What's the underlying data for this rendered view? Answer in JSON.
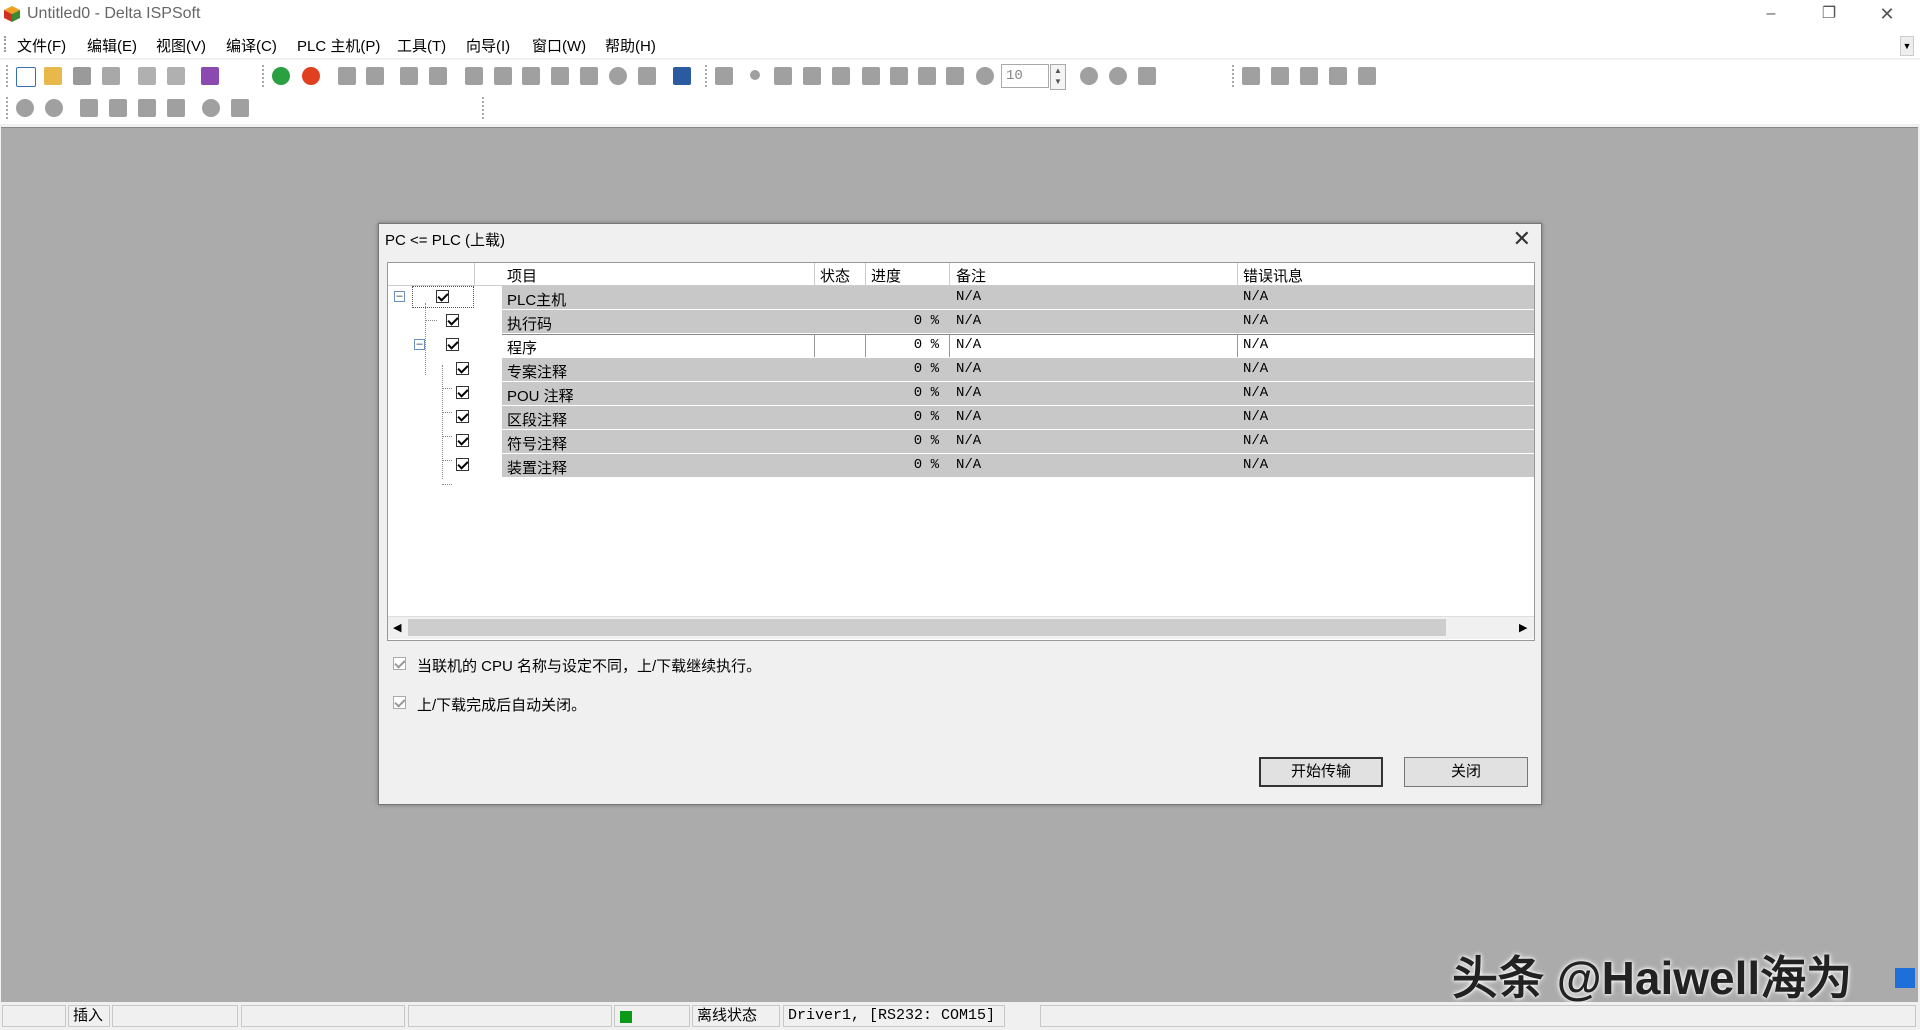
{
  "window": {
    "title": "Untitled0 - Delta ISPSoft"
  },
  "menu": [
    "文件(F)",
    "编辑(E)",
    "视图(V)",
    "编译(C)",
    "PLC 主机(P)",
    "工具(T)",
    "向导(I)",
    "窗口(W)",
    "帮助(H)"
  ],
  "toolbar": {
    "spin_value": "10"
  },
  "dialog": {
    "title": "PC <= PLC (上载)",
    "columns": {
      "item": "项目",
      "status": "状态",
      "progress": "进度",
      "note": "备注",
      "error": "错误讯息"
    },
    "rows": [
      {
        "label": "PLC主机",
        "status": "",
        "progress": "",
        "note": "N/A",
        "error": "N/A",
        "checked": true
      },
      {
        "label": "执行码",
        "status": "",
        "progress": "0 %",
        "note": "N/A",
        "error": "N/A",
        "checked": true
      },
      {
        "label": "程序",
        "status": "",
        "progress": "0 %",
        "note": "N/A",
        "error": "N/A",
        "checked": true
      },
      {
        "label": "专案注释",
        "status": "",
        "progress": "0 %",
        "note": "N/A",
        "error": "N/A",
        "checked": true
      },
      {
        "label": "POU 注释",
        "status": "",
        "progress": "0 %",
        "note": "N/A",
        "error": "N/A",
        "checked": true
      },
      {
        "label": "区段注释",
        "status": "",
        "progress": "0 %",
        "note": "N/A",
        "error": "N/A",
        "checked": true
      },
      {
        "label": "符号注释",
        "status": "",
        "progress": "0 %",
        "note": "N/A",
        "error": "N/A",
        "checked": true
      },
      {
        "label": "装置注释",
        "status": "",
        "progress": "0 %",
        "note": "N/A",
        "error": "N/A",
        "checked": true
      }
    ],
    "options": [
      {
        "label": "当联机的 CPU 名称与设定不同，上/下载继续执行。",
        "checked": true
      },
      {
        "label": "上/下载完成后自动关闭。",
        "checked": true
      }
    ],
    "start_button": "开始传输",
    "close_button": "关闭"
  },
  "statusbar": {
    "mode": "插入",
    "connection_state": "离线状态",
    "driver": "Driver1, [RS232: COM15]",
    "led_color": "#0a9a1a"
  },
  "watermark": "头条 @Haiwell海为"
}
